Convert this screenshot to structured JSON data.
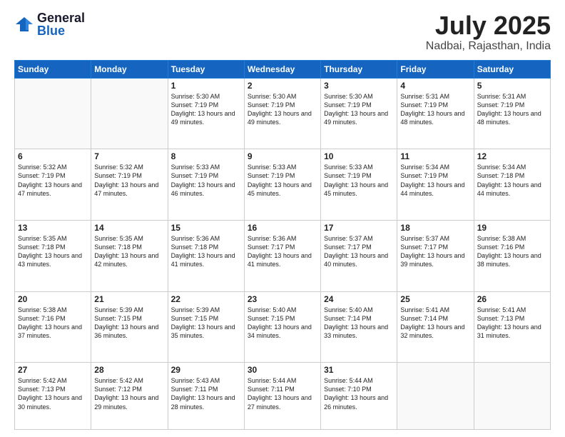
{
  "logo": {
    "general": "General",
    "blue": "Blue"
  },
  "header": {
    "month": "July 2025",
    "location": "Nadbai, Rajasthan, India"
  },
  "days_of_week": [
    "Sunday",
    "Monday",
    "Tuesday",
    "Wednesday",
    "Thursday",
    "Friday",
    "Saturday"
  ],
  "weeks": [
    [
      {
        "day": "",
        "info": ""
      },
      {
        "day": "",
        "info": ""
      },
      {
        "day": "1",
        "info": "Sunrise: 5:30 AM\nSunset: 7:19 PM\nDaylight: 13 hours and 49 minutes."
      },
      {
        "day": "2",
        "info": "Sunrise: 5:30 AM\nSunset: 7:19 PM\nDaylight: 13 hours and 49 minutes."
      },
      {
        "day": "3",
        "info": "Sunrise: 5:30 AM\nSunset: 7:19 PM\nDaylight: 13 hours and 49 minutes."
      },
      {
        "day": "4",
        "info": "Sunrise: 5:31 AM\nSunset: 7:19 PM\nDaylight: 13 hours and 48 minutes."
      },
      {
        "day": "5",
        "info": "Sunrise: 5:31 AM\nSunset: 7:19 PM\nDaylight: 13 hours and 48 minutes."
      }
    ],
    [
      {
        "day": "6",
        "info": "Sunrise: 5:32 AM\nSunset: 7:19 PM\nDaylight: 13 hours and 47 minutes."
      },
      {
        "day": "7",
        "info": "Sunrise: 5:32 AM\nSunset: 7:19 PM\nDaylight: 13 hours and 47 minutes."
      },
      {
        "day": "8",
        "info": "Sunrise: 5:33 AM\nSunset: 7:19 PM\nDaylight: 13 hours and 46 minutes."
      },
      {
        "day": "9",
        "info": "Sunrise: 5:33 AM\nSunset: 7:19 PM\nDaylight: 13 hours and 45 minutes."
      },
      {
        "day": "10",
        "info": "Sunrise: 5:33 AM\nSunset: 7:19 PM\nDaylight: 13 hours and 45 minutes."
      },
      {
        "day": "11",
        "info": "Sunrise: 5:34 AM\nSunset: 7:19 PM\nDaylight: 13 hours and 44 minutes."
      },
      {
        "day": "12",
        "info": "Sunrise: 5:34 AM\nSunset: 7:18 PM\nDaylight: 13 hours and 44 minutes."
      }
    ],
    [
      {
        "day": "13",
        "info": "Sunrise: 5:35 AM\nSunset: 7:18 PM\nDaylight: 13 hours and 43 minutes."
      },
      {
        "day": "14",
        "info": "Sunrise: 5:35 AM\nSunset: 7:18 PM\nDaylight: 13 hours and 42 minutes."
      },
      {
        "day": "15",
        "info": "Sunrise: 5:36 AM\nSunset: 7:18 PM\nDaylight: 13 hours and 41 minutes."
      },
      {
        "day": "16",
        "info": "Sunrise: 5:36 AM\nSunset: 7:17 PM\nDaylight: 13 hours and 41 minutes."
      },
      {
        "day": "17",
        "info": "Sunrise: 5:37 AM\nSunset: 7:17 PM\nDaylight: 13 hours and 40 minutes."
      },
      {
        "day": "18",
        "info": "Sunrise: 5:37 AM\nSunset: 7:17 PM\nDaylight: 13 hours and 39 minutes."
      },
      {
        "day": "19",
        "info": "Sunrise: 5:38 AM\nSunset: 7:16 PM\nDaylight: 13 hours and 38 minutes."
      }
    ],
    [
      {
        "day": "20",
        "info": "Sunrise: 5:38 AM\nSunset: 7:16 PM\nDaylight: 13 hours and 37 minutes."
      },
      {
        "day": "21",
        "info": "Sunrise: 5:39 AM\nSunset: 7:15 PM\nDaylight: 13 hours and 36 minutes."
      },
      {
        "day": "22",
        "info": "Sunrise: 5:39 AM\nSunset: 7:15 PM\nDaylight: 13 hours and 35 minutes."
      },
      {
        "day": "23",
        "info": "Sunrise: 5:40 AM\nSunset: 7:15 PM\nDaylight: 13 hours and 34 minutes."
      },
      {
        "day": "24",
        "info": "Sunrise: 5:40 AM\nSunset: 7:14 PM\nDaylight: 13 hours and 33 minutes."
      },
      {
        "day": "25",
        "info": "Sunrise: 5:41 AM\nSunset: 7:14 PM\nDaylight: 13 hours and 32 minutes."
      },
      {
        "day": "26",
        "info": "Sunrise: 5:41 AM\nSunset: 7:13 PM\nDaylight: 13 hours and 31 minutes."
      }
    ],
    [
      {
        "day": "27",
        "info": "Sunrise: 5:42 AM\nSunset: 7:13 PM\nDaylight: 13 hours and 30 minutes."
      },
      {
        "day": "28",
        "info": "Sunrise: 5:42 AM\nSunset: 7:12 PM\nDaylight: 13 hours and 29 minutes."
      },
      {
        "day": "29",
        "info": "Sunrise: 5:43 AM\nSunset: 7:11 PM\nDaylight: 13 hours and 28 minutes."
      },
      {
        "day": "30",
        "info": "Sunrise: 5:44 AM\nSunset: 7:11 PM\nDaylight: 13 hours and 27 minutes."
      },
      {
        "day": "31",
        "info": "Sunrise: 5:44 AM\nSunset: 7:10 PM\nDaylight: 13 hours and 26 minutes."
      },
      {
        "day": "",
        "info": ""
      },
      {
        "day": "",
        "info": ""
      }
    ]
  ]
}
